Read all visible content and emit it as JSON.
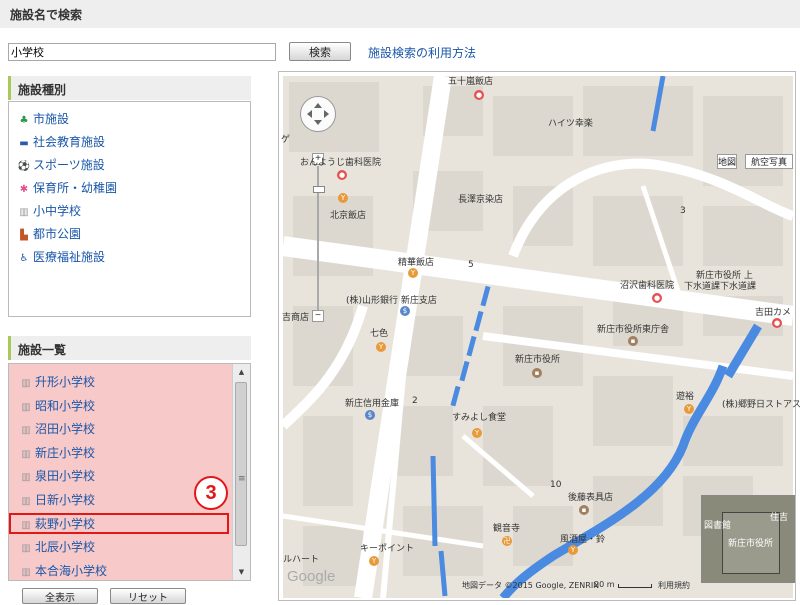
{
  "search": {
    "header": "施設名で検索",
    "input_value": "小学校",
    "button_label": "検索",
    "help_link": "施設検索の利用方法"
  },
  "facility_types": {
    "header": "施設種別",
    "items": [
      {
        "label": "市施設",
        "icon": "sprout-icon",
        "color": "#2a9a4a"
      },
      {
        "label": "社会教育施設",
        "icon": "laptop-icon",
        "color": "#2a5aa8"
      },
      {
        "label": "スポーツ施設",
        "icon": "soccer-ball-icon",
        "color": "#222222"
      },
      {
        "label": "保育所・幼稚園",
        "icon": "flower-icon",
        "color": "#e0508a"
      },
      {
        "label": "小中学校",
        "icon": "school-icon",
        "color": "#9a9a9a"
      },
      {
        "label": "都市公園",
        "icon": "park-icon",
        "color": "#c0562a"
      },
      {
        "label": "医療福祉施設",
        "icon": "wheelchair-icon",
        "color": "#2a5aa8"
      }
    ]
  },
  "facility_list": {
    "header": "施設一覧",
    "items": [
      "升形小学校",
      "昭和小学校",
      "沼田小学校",
      "新庄小学校",
      "泉田小学校",
      "日新小学校",
      "萩野小学校",
      "北辰小学校",
      "本合海小学校"
    ],
    "highlighted_index": 6,
    "step_badge": "3"
  },
  "buttons": {
    "show_all": "全表示",
    "reset": "リセット"
  },
  "map": {
    "type_buttons": [
      "地図",
      "航空写真"
    ],
    "labels": {
      "dental": "おんようじ歯科医院",
      "haitsu": "ハイツ幸楽",
      "chosawa": "長澤京染店",
      "hokkyo": "北京飯店",
      "seika": "精華飯店",
      "yamagata_bank": "(株)山形銀行 新庄支店",
      "numazawa_dental": "沼沢歯科医院",
      "city_office_upper": "新庄市役所 上",
      "city_office_upper2": "下水道課下水道課",
      "yoshida": "吉田カメ",
      "city_office_east": "新庄市役所東庁舎",
      "nanairo": "七色",
      "city_office": "新庄市役所",
      "credit_union": "新庄信用金庫",
      "sumiyoshi": "すみよし食堂",
      "yuyu": "遊裕",
      "gobo_store": "(株)郷野日ストアス",
      "gotou": "後藤表具店",
      "kanjoji": "観音寺",
      "kazemaya": "風酒屋・鈴",
      "keypoint": "キーポイント",
      "heart": "ルハート",
      "hanten_top": "五十嵐飯店",
      "kyoyo_left": "吉商店",
      "ge": "ゲ",
      "block2": "2",
      "block3": "3",
      "block5": "5",
      "block10": "10",
      "ovw_city": "新庄市役所",
      "ovw_shoi": "図書館",
      "ovw_sumi": "住吉"
    },
    "attribution": "地図データ ©2015 Google, ZENRIN",
    "scale": "20 m",
    "terms": "利用規約",
    "logo": "Google"
  },
  "colors": {
    "highlight": "#e01818",
    "list_bg": "#f8c9c9",
    "link": "#1a56a8",
    "water": "#4a8ae0"
  }
}
